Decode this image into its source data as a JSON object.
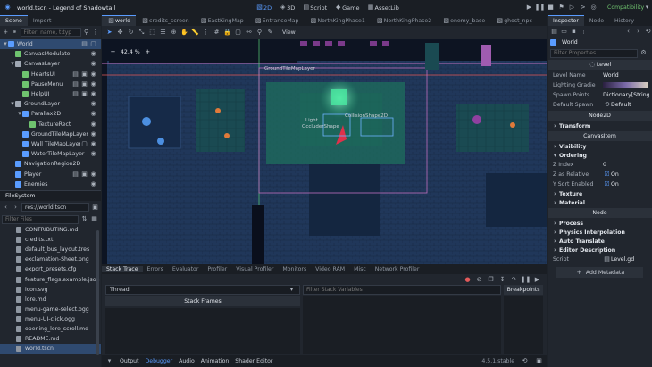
{
  "window": {
    "title": "world.tscn - Legend of Shadowtail",
    "renderer": "Compatibility"
  },
  "workspaces": [
    "2D",
    "3D",
    "Script",
    "Game",
    "AssetLib"
  ],
  "colors": {
    "accent": "#5a9cff",
    "panel": "#21262e",
    "bg": "#1d2229",
    "viewport": "#0d1422"
  },
  "scene_dock": {
    "tabs": [
      "Scene",
      "Import"
    ],
    "filter_placeholder": "Filter: name, t:typ",
    "nodes": [
      {
        "name": "World",
        "depth": 0,
        "icon": "#5a9cff",
        "sel": true,
        "trail": [
          "script-icon",
          "group-icon"
        ]
      },
      {
        "name": "CanvasModulate",
        "depth": 1,
        "icon": "#6fc36f",
        "trail": [
          "eye-icon"
        ]
      },
      {
        "name": "CanvasLayer",
        "depth": 1,
        "icon": "#a0a8b4",
        "trail": [
          "eye-icon"
        ]
      },
      {
        "name": "HeartsUI",
        "depth": 2,
        "icon": "#6fc36f",
        "trail": [
          "script-icon",
          "clapboard-icon",
          "eye-icon"
        ]
      },
      {
        "name": "PauseMenu",
        "depth": 2,
        "icon": "#6fc36f",
        "trail": [
          "script-icon",
          "clapboard-icon",
          "eye-icon"
        ]
      },
      {
        "name": "HelpUI",
        "depth": 2,
        "icon": "#6fc36f",
        "trail": [
          "script-icon",
          "clapboard-icon",
          "eye-icon"
        ]
      },
      {
        "name": "GroundLayer",
        "depth": 1,
        "icon": "#a0a8b4",
        "trail": [
          "eye-icon"
        ]
      },
      {
        "name": "Parallax2D",
        "depth": 2,
        "icon": "#5a9cff",
        "trail": [
          "eye-icon"
        ]
      },
      {
        "name": "TextureRect",
        "depth": 3,
        "icon": "#6fc36f",
        "trail": [
          "eye-icon"
        ]
      },
      {
        "name": "GroundTileMapLayer",
        "depth": 2,
        "icon": "#5a9cff",
        "trail": [
          "eye-icon"
        ]
      },
      {
        "name": "Wall TileMapLayer",
        "depth": 2,
        "icon": "#5a9cff",
        "trail": [
          "group-icon",
          "eye-icon"
        ]
      },
      {
        "name": "WaterTileMapLayer",
        "depth": 2,
        "icon": "#5a9cff",
        "trail": [
          "eye-icon"
        ]
      },
      {
        "name": "NavigationRegion2D",
        "depth": 1,
        "icon": "#5a9cff",
        "trail": []
      },
      {
        "name": "Player",
        "depth": 1,
        "icon": "#5a9cff",
        "trail": [
          "script-icon",
          "clapboard-icon",
          "eye-icon"
        ]
      },
      {
        "name": "Enemies",
        "depth": 1,
        "icon": "#5a9cff",
        "trail": [
          "eye-icon"
        ]
      }
    ]
  },
  "filesystem": {
    "title": "FileSystem",
    "path": "res://world.tscn",
    "filter_placeholder": "Filter Files",
    "files": [
      "CONTRIBUTING.md",
      "credits.txt",
      "default_bus_layout.tres",
      "exclamation-Sheet.png",
      "export_presets.cfg",
      "feature_flags.example.json",
      "icon.svg",
      "lore.md",
      "menu-game-select.ogg",
      "menu-UI-click.ogg",
      "opening_lore_scroll.md",
      "README.md",
      "world.tscn"
    ]
  },
  "editor_tabs": [
    "world",
    "credits_screen",
    "EastKingMap",
    "EntranceMap",
    "NorthKingPhase1",
    "NorthKingPhase2",
    "enemy_base",
    "ghost_npc"
  ],
  "viewport": {
    "zoom": "42.4 %",
    "view_label": "View",
    "labels": {
      "ground": "GroundTileMapLayer",
      "light": "Light",
      "occluder": "OccluderShape",
      "collision": "CollisionShape2D"
    }
  },
  "inspector": {
    "tabs": [
      "Inspector",
      "Node",
      "History"
    ],
    "node": "World",
    "filter_placeholder": "Filter Properties",
    "level_header": "Level",
    "props": [
      {
        "k": "Level Name",
        "v": "World"
      },
      {
        "k": "Lighting Gradie",
        "v": ""
      },
      {
        "k": "Spawn Points",
        "v": "Dictionary[String..."
      },
      {
        "k": "Default Spawn",
        "v": "Default"
      }
    ],
    "node2d": "Node2D",
    "transform": "Transform",
    "canvas_item": "CanvasItem",
    "visibility": "Visibility",
    "ordering": "Ordering",
    "ordering_props": [
      {
        "k": "Z Index",
        "v": "0"
      },
      {
        "k": "Z as Relative",
        "v": "On"
      },
      {
        "k": "Y Sort Enabled",
        "v": "On"
      }
    ],
    "texture": "Texture",
    "material": "Material",
    "node_header": "Node",
    "node_cats": [
      "Process",
      "Physics Interpolation",
      "Auto Translate",
      "Editor Description"
    ],
    "script_label": "Script",
    "script_value": "Level.gd",
    "add_metadata": "Add Metadata"
  },
  "debugger": {
    "tabs": [
      "Stack Trace",
      "Errors",
      "Evaluator",
      "Profiler",
      "Visual Profiler",
      "Monitors",
      "Video RAM",
      "Misc",
      "Network Profiler"
    ],
    "thread": "Thread",
    "stack_frames": "Stack Frames",
    "filter_vars_placeholder": "Filter Stack Variables",
    "breakpoints": "Breakpoints"
  },
  "bottom_bar": {
    "tabs": [
      "Output",
      "Debugger",
      "Audio",
      "Animation",
      "Shader Editor"
    ],
    "version": "4.5.1.stable"
  }
}
